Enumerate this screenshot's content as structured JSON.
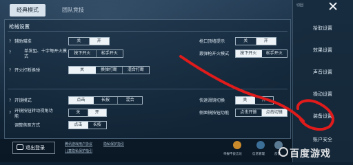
{
  "tabs": [
    "经典模式",
    "团队竞技"
  ],
  "section": {
    "title": "枪械设置"
  },
  "rows": {
    "assist_aim": {
      "help": "?",
      "label": "辅助瞄准",
      "options": [
        "关",
        "开"
      ],
      "selected": 1
    },
    "scope_fire": {
      "label": "单发狙、十字弩开火模式",
      "options": [
        "按下开火",
        "松手开火"
      ],
      "selected": -1
    },
    "scope_fire_help": "?",
    "fire_scope": {
      "help": "?",
      "label": "开火打断换弹",
      "options": [
        "关",
        "换弹打断",
        "混合打断"
      ],
      "selected": 0
    },
    "mouth_rotate": {
      "label": "枪口顶墙提示",
      "options": [
        "关",
        "开"
      ],
      "selected": 1
    },
    "sniper_mode": {
      "label": "霰弹枪开火模式",
      "options": [
        "按下开火",
        "松手开火"
      ],
      "selected": 0
    },
    "open_scope": {
      "help": "?",
      "label": "开镜模式",
      "options": [
        "点击",
        "长按",
        "混合"
      ],
      "selected": 0
    },
    "aim_view": {
      "help": "?",
      "label": "开镜按钮转动视角功能",
      "options": [
        "关",
        "开"
      ],
      "selected": 1
    },
    "focus_mode": {
      "label": "调整焦距方式",
      "options": [
        "点击",
        "长按"
      ],
      "selected": 0
    },
    "quick_switch": {
      "label": "快速滑镜切换",
      "options": [
        "关",
        "开"
      ],
      "selected": 0
    },
    "side_scope": {
      "label": "侧面镜按钮功能",
      "options": [
        "点击开镜",
        "点击切镜"
      ],
      "selected": 1
    }
  },
  "sidebar": {
    "top": "切回",
    "items": [
      "拾取设置",
      "效果设置",
      "声音设置",
      "操动设置",
      "装备设置",
      "账户安全"
    ]
  },
  "bottom": {
    "logout": "退出登录",
    "links": [
      "腾讯游戏用户协议",
      "隐私保护指引",
      "儿童隐私保护指引"
    ],
    "icons": [
      "举报不良言论",
      "信息管理",
      "反馈"
    ]
  },
  "watermark": "百度游戏",
  "colors": {
    "accent": "#e01b1b",
    "panel": "#14293c"
  }
}
